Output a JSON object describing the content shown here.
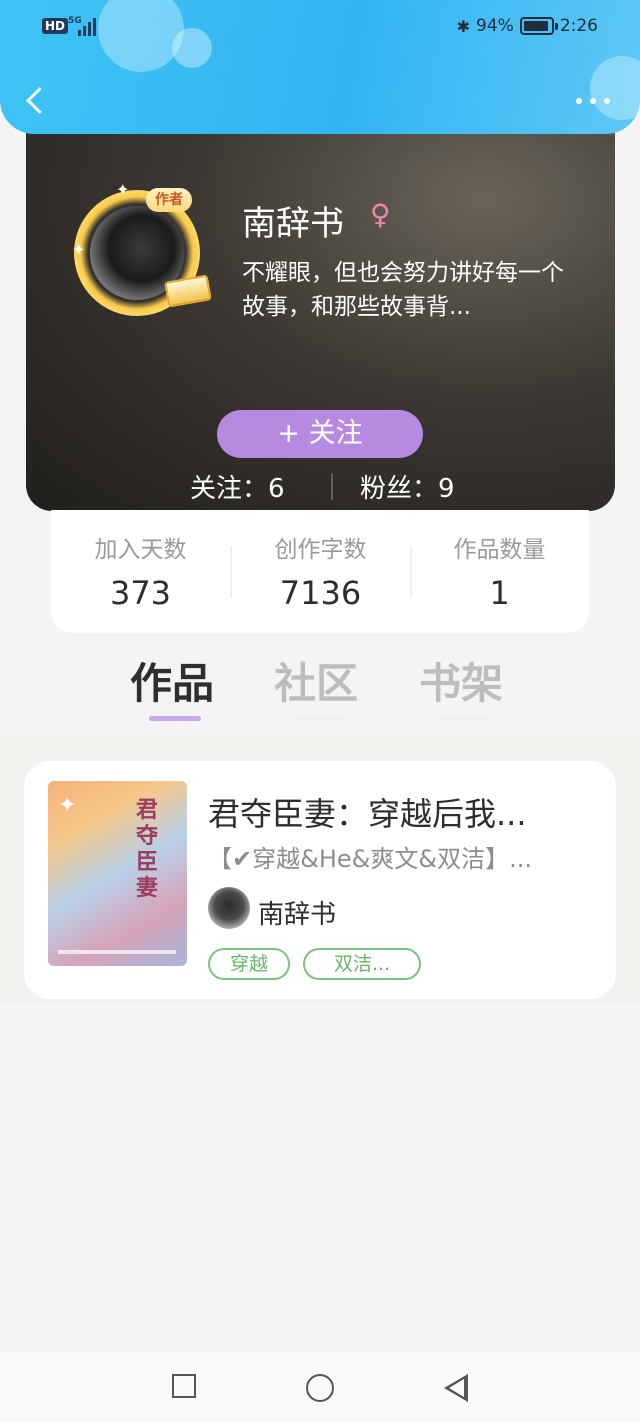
{
  "status_bar": {
    "network": "HD",
    "signal_type": "5G",
    "battery_percent": "94%",
    "time": "2:26"
  },
  "profile": {
    "author_tag": "作者",
    "name": "南辞书",
    "gender_icon": "female-icon",
    "bio": "不耀眼，但也会努力讲好每一个故事，和那些故事背...",
    "follow_button": "+ 关注",
    "follow_count_label": "关注：",
    "follow_count": "6",
    "fans_label": "粉丝：",
    "fans_count": "9"
  },
  "stats": [
    {
      "label": "加入天数",
      "value": "373"
    },
    {
      "label": "创作字数",
      "value": "7136"
    },
    {
      "label": "作品数量",
      "value": "1"
    }
  ],
  "tabs": [
    {
      "label": "作品",
      "active": true
    },
    {
      "label": "社区",
      "active": false
    },
    {
      "label": "书架",
      "active": false
    }
  ],
  "work": {
    "title": "君夺臣妻：穿越后我...",
    "description": "【✔穿越&He&爽文&双洁】...",
    "author": "南辞书",
    "cover_title": "君夺臣妻",
    "tags": [
      "穿越",
      "双洁..."
    ]
  },
  "colors": {
    "header_blue": "#36b8f3",
    "follow_button": "#b68ae0",
    "tab_indicator": "#c9a6e6",
    "tag_green": "#7ec27e"
  }
}
